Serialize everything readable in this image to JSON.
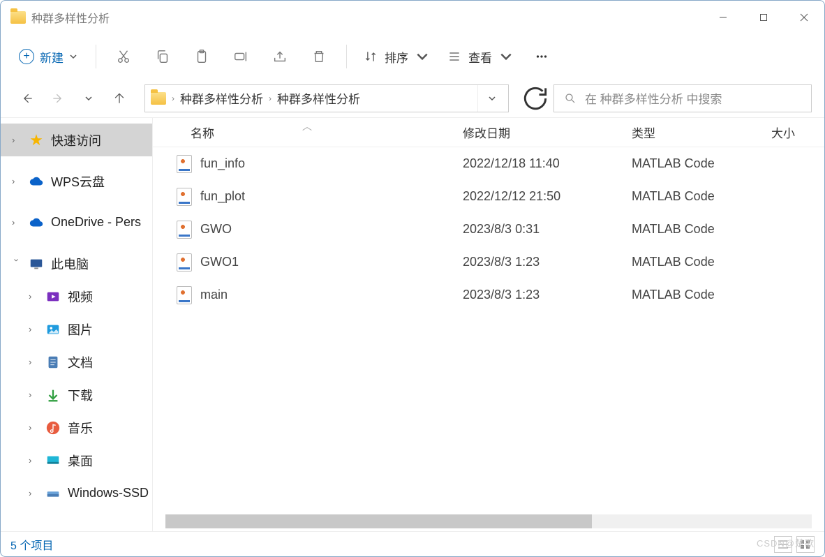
{
  "window": {
    "title": "种群多样性分析"
  },
  "toolbar": {
    "new_label": "新建",
    "sort_label": "排序",
    "view_label": "查看"
  },
  "breadcrumb": {
    "items": [
      "种群多样性分析",
      "种群多样性分析"
    ]
  },
  "search": {
    "placeholder": "在 种群多样性分析 中搜索"
  },
  "columns": {
    "name": "名称",
    "date": "修改日期",
    "type": "类型",
    "size": "大小"
  },
  "sidebar": {
    "quick_access": "快速访问",
    "wps": "WPS云盘",
    "onedrive": "OneDrive - Pers",
    "this_pc": "此电脑",
    "videos": "视频",
    "pictures": "图片",
    "documents": "文档",
    "downloads": "下载",
    "music": "音乐",
    "desktop": "桌面",
    "windows_ssd": "Windows-SSD"
  },
  "files": [
    {
      "name": "fun_info",
      "date": "2022/12/18 11:40",
      "type": "MATLAB Code"
    },
    {
      "name": "fun_plot",
      "date": "2022/12/12 21:50",
      "type": "MATLAB Code"
    },
    {
      "name": "GWO",
      "date": "2023/8/3 0:31",
      "type": "MATLAB Code"
    },
    {
      "name": "GWO1",
      "date": "2023/8/3 1:23",
      "type": "MATLAB Code"
    },
    {
      "name": "main",
      "date": "2023/8/3 1:23",
      "type": "MATLAB Code"
    }
  ],
  "status": {
    "text": "5 个项目"
  },
  "watermark": "CSDN@楚歌"
}
